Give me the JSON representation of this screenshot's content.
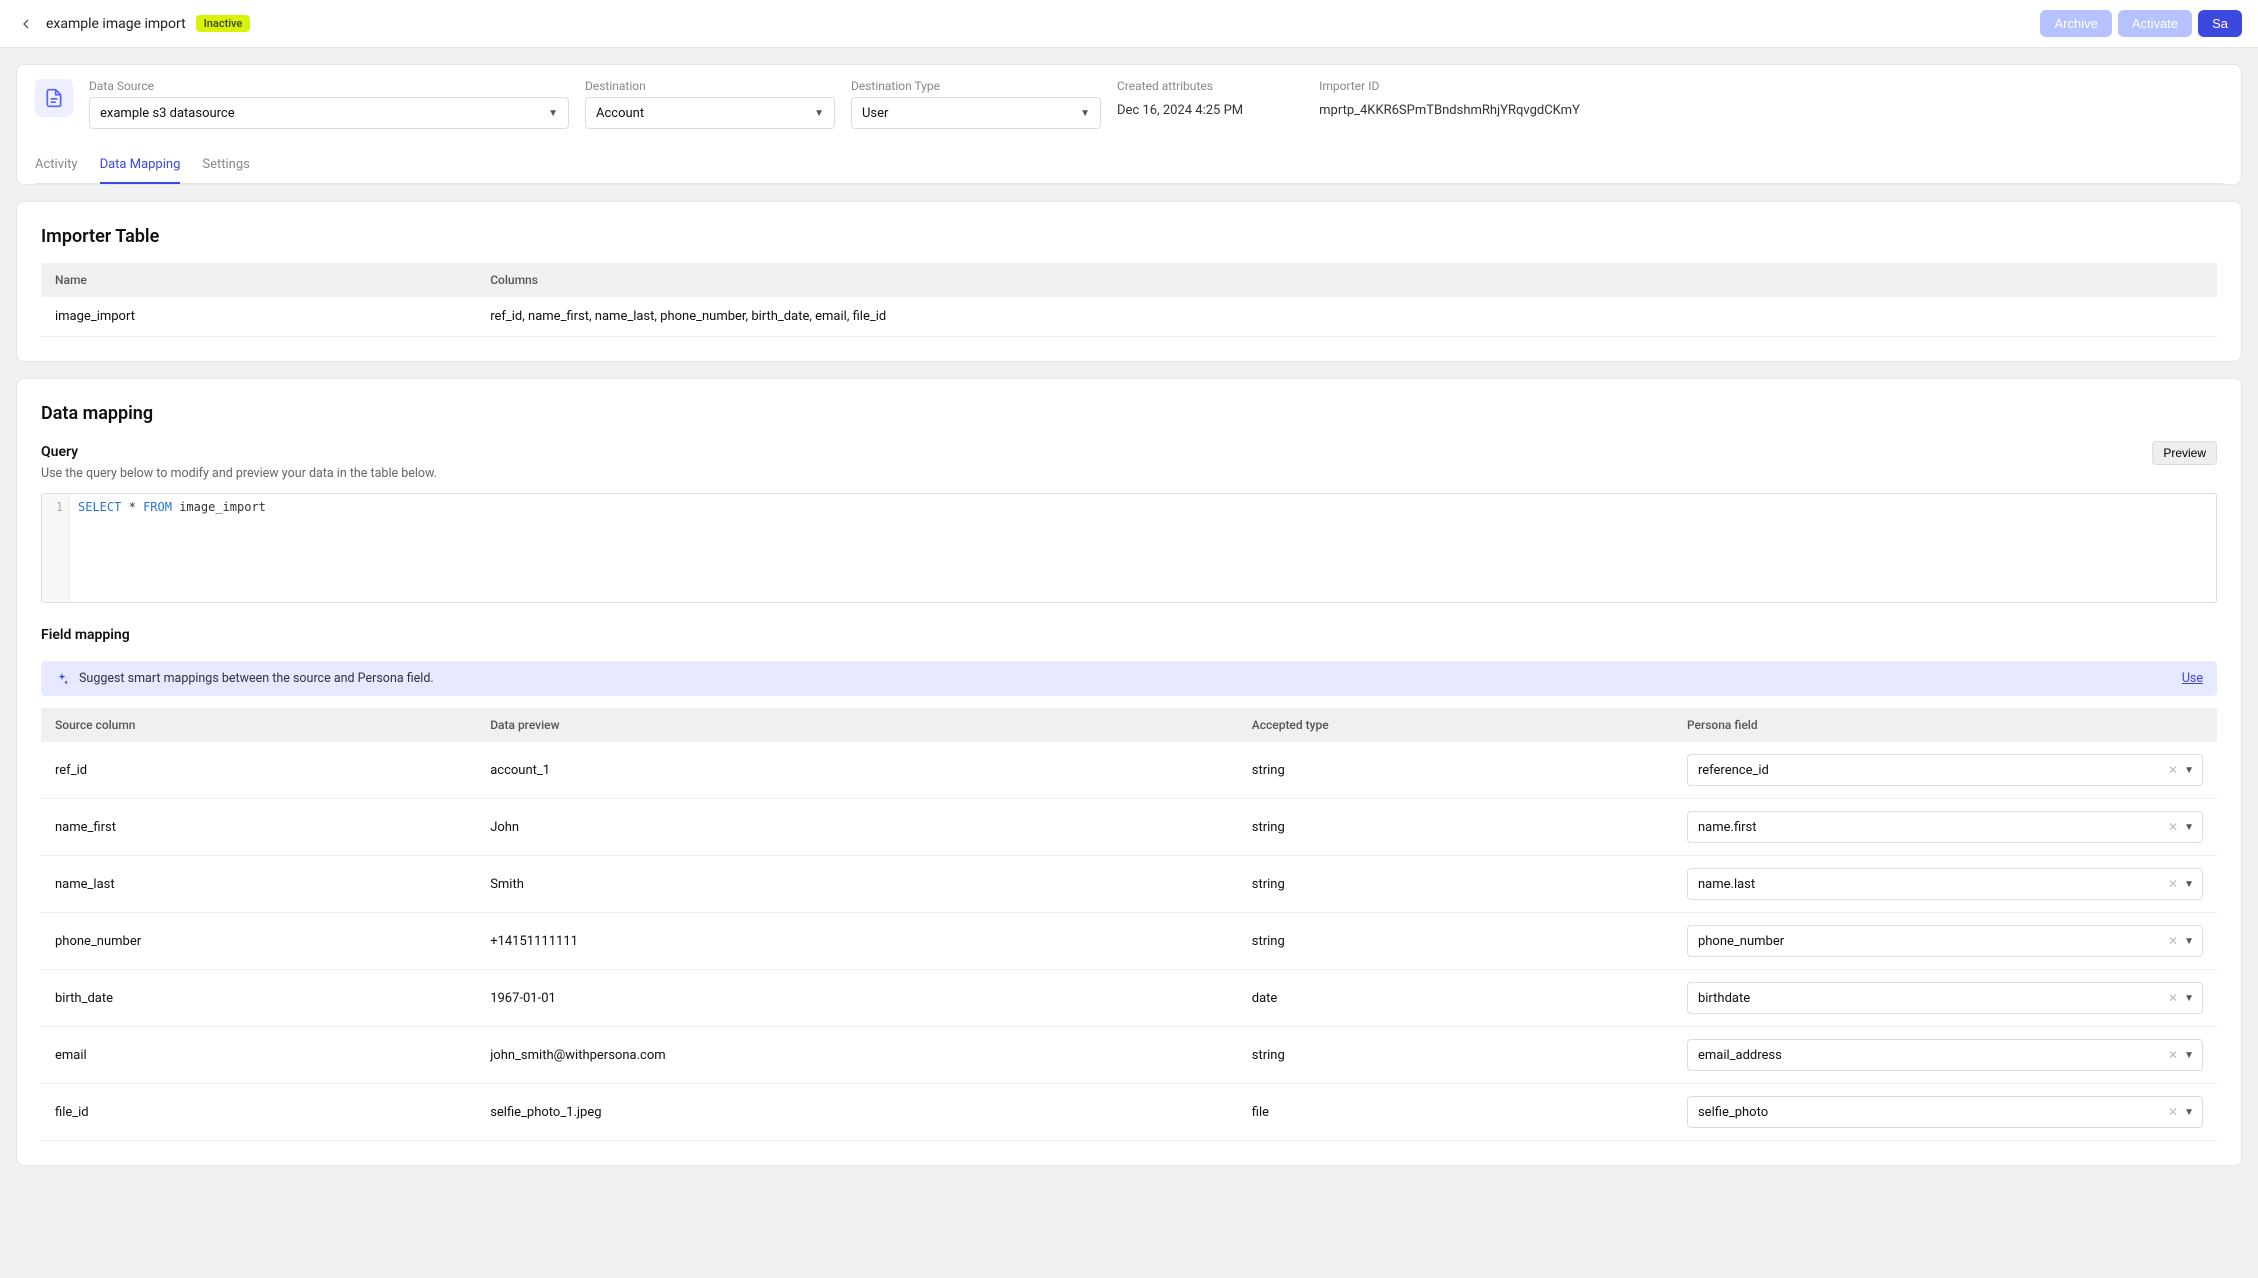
{
  "topbar": {
    "title": "example image import",
    "status": "Inactive",
    "archive": "Archive",
    "activate": "Activate",
    "save": "Sa"
  },
  "config": {
    "fields": {
      "data_source": {
        "label": "Data Source",
        "value": "example s3 datasource"
      },
      "destination": {
        "label": "Destination",
        "value": "Account"
      },
      "destination_type": {
        "label": "Destination Type",
        "value": "User"
      },
      "created_attributes": {
        "label": "Created attributes",
        "value": "Dec 16, 2024 4:25 PM"
      },
      "importer_id": {
        "label": "Importer ID",
        "value": "mprtp_4KKR6SPmTBndshmRhjYRqvgdCKmY"
      }
    },
    "tabs": {
      "activity": "Activity",
      "data_mapping": "Data Mapping",
      "settings": "Settings"
    }
  },
  "importer_table": {
    "title": "Importer Table",
    "headers": {
      "name": "Name",
      "columns": "Columns"
    },
    "row": {
      "name": "image_import",
      "columns": "ref_id, name_first, name_last, phone_number, birth_date, email, file_id"
    }
  },
  "data_mapping": {
    "title": "Data mapping",
    "query_label": "Query",
    "preview_label": "Preview",
    "helper": "Use the query below to modify and preview your data in the table below.",
    "query_line_no": "1",
    "query_kw1": "SELECT",
    "query_star": "*",
    "query_kw2": "FROM",
    "query_table": "image_import",
    "field_mapping_label": "Field mapping",
    "suggest_text": "Suggest smart mappings between the source and Persona field.",
    "suggest_action": "Use",
    "columns": {
      "source": "Source column",
      "preview": "Data preview",
      "type": "Accepted type",
      "persona": "Persona field"
    },
    "rows": [
      {
        "source": "ref_id",
        "preview": "account_1",
        "type": "string",
        "persona": "reference_id"
      },
      {
        "source": "name_first",
        "preview": "John",
        "type": "string",
        "persona": "name.first"
      },
      {
        "source": "name_last",
        "preview": "Smith",
        "type": "string",
        "persona": "name.last"
      },
      {
        "source": "phone_number",
        "preview": "+14151111111",
        "type": "string",
        "persona": "phone_number"
      },
      {
        "source": "birth_date",
        "preview": "1967-01-01",
        "type": "date",
        "persona": "birthdate"
      },
      {
        "source": "email",
        "preview": "john_smith@withpersona.com",
        "type": "string",
        "persona": "email_address"
      },
      {
        "source": "file_id",
        "preview": "selfie_photo_1.jpeg",
        "type": "file",
        "persona": "selfie_photo"
      }
    ]
  }
}
